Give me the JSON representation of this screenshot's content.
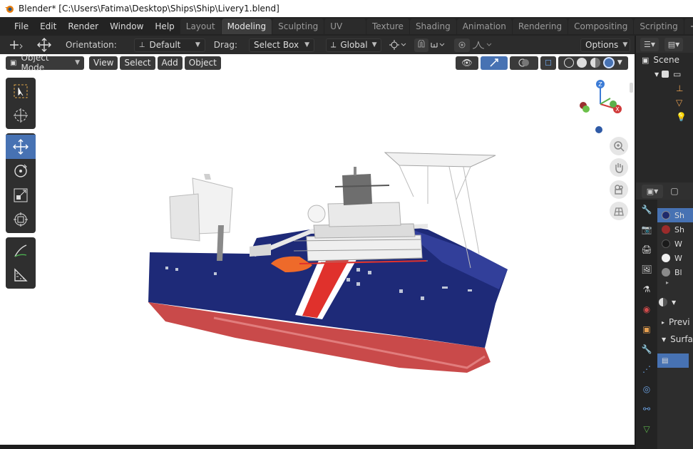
{
  "window": {
    "title": "Blender* [C:\\Users\\Fatima\\Desktop\\Ships\\Ship\\Livery1.blend]"
  },
  "menu": [
    "File",
    "Edit",
    "Render",
    "Window",
    "Help"
  ],
  "workspaces": [
    "Layout",
    "Modeling",
    "Sculpting",
    "UV Editing",
    "Texture Paint",
    "Shading",
    "Animation",
    "Rendering",
    "Compositing",
    "Scripting"
  ],
  "active_workspace": "Modeling",
  "header": {
    "orientation_label": "Orientation:",
    "orientation_value": "Default",
    "drag_label": "Drag:",
    "drag_value": "Select Box",
    "transform_value": "Global",
    "options_label": "Options"
  },
  "viewport": {
    "mode": "Object Mode",
    "menus": [
      "View",
      "Select",
      "Add",
      "Object"
    ],
    "gizmo_axes": [
      "Z",
      "Y",
      "X"
    ]
  },
  "outliner": {
    "title": "Scene"
  },
  "materials": [
    {
      "name": "Sh",
      "color": "#1f2a6b"
    },
    {
      "name": "Sh",
      "color": "#9b2b2b"
    },
    {
      "name": "W",
      "color": "#1a1a1a"
    },
    {
      "name": "W",
      "color": "#f0f0f0"
    },
    {
      "name": "Bl",
      "color": "#8a8a8a"
    }
  ],
  "properties": {
    "sections": [
      "Previ",
      "Surfa"
    ]
  },
  "colors": {
    "accent": "#4772b3",
    "hull_blue": "#1e2a78",
    "hull_red": "#c94a4a",
    "stripe_red": "#e0312c"
  }
}
